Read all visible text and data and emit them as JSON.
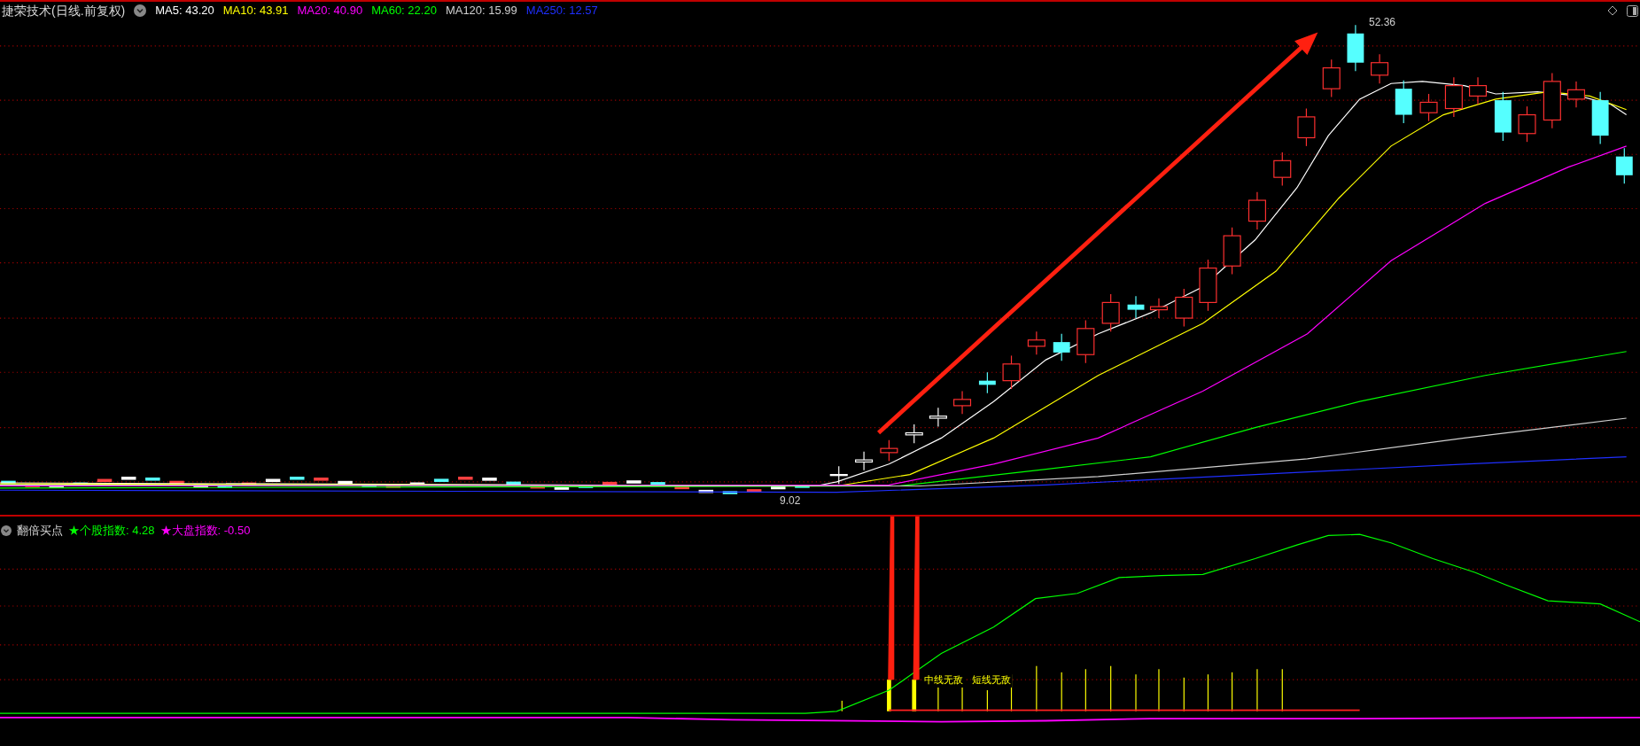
{
  "title": "捷荣技术(日线.前复权)",
  "ma_legend": [
    {
      "label": "MA5: 43.20",
      "color": "#ffffff"
    },
    {
      "label": "MA10: 43.91",
      "color": "#ffff00"
    },
    {
      "label": "MA20: 40.90",
      "color": "#ff00ff"
    },
    {
      "label": "MA60: 22.20",
      "color": "#00ff00"
    },
    {
      "label": "MA120: 15.99",
      "color": "#d0d0d0"
    },
    {
      "label": "MA250: 12.57",
      "color": "#1f2fff"
    }
  ],
  "price_labels": {
    "high": "52.36",
    "low": "9.02"
  },
  "indicator": {
    "title": "翻倍买点",
    "legend": [
      {
        "label": "★个股指数: 4.28",
        "color": "#00ff00"
      },
      {
        "label": "★大盘指数: -0.50",
        "color": "#ff00ff"
      }
    ],
    "signals": [
      "中线无敌",
      "短线无敌"
    ]
  }
}
